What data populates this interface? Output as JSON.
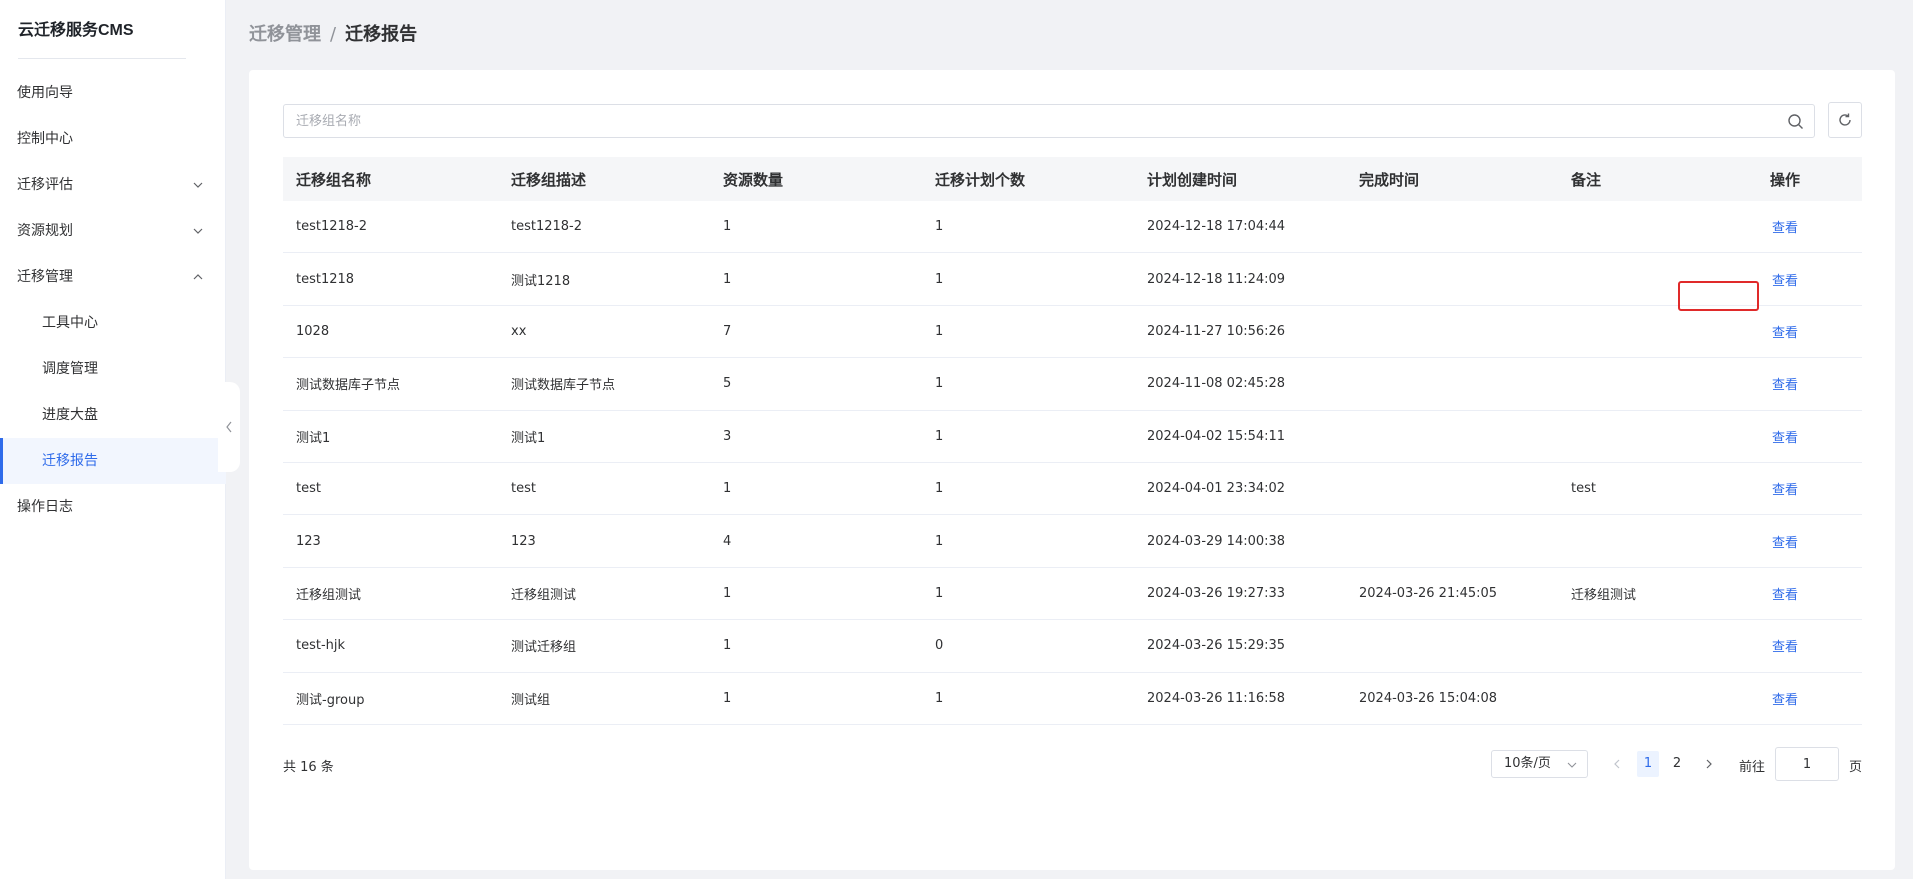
{
  "sidebar": {
    "brand": "云迁移服务CMS",
    "items": [
      {
        "label": "使用向导"
      },
      {
        "label": "控制中心"
      },
      {
        "label": "迁移评估"
      },
      {
        "label": "资源规划"
      },
      {
        "label": "迁移管理"
      },
      {
        "label": "工具中心"
      },
      {
        "label": "调度管理"
      },
      {
        "label": "进度大盘"
      },
      {
        "label": "迁移报告"
      },
      {
        "label": "操作日志"
      }
    ]
  },
  "breadcrumb": {
    "parent": "迁移管理",
    "separator": "/",
    "current": "迁移报告"
  },
  "search": {
    "placeholder": "迁移组名称",
    "value": ""
  },
  "table": {
    "headers": [
      "迁移组名称",
      "迁移组描述",
      "资源数量",
      "迁移计划个数",
      "计划创建时间",
      "完成时间",
      "备注",
      "操作"
    ],
    "rows": [
      {
        "name": "test1218-2",
        "desc": "test1218-2",
        "resources": "1",
        "plans": "1",
        "created": "2024-12-18 17:04:44",
        "completed": "",
        "note": "",
        "action": "查看"
      },
      {
        "name": "test1218",
        "desc": "测试1218",
        "resources": "1",
        "plans": "1",
        "created": "2024-12-18 11:24:09",
        "completed": "",
        "note": "",
        "action": "查看"
      },
      {
        "name": "1028",
        "desc": "xx",
        "resources": "7",
        "plans": "1",
        "created": "2024-11-27 10:56:26",
        "completed": "",
        "note": "",
        "action": "查看"
      },
      {
        "name": "测试数据库子节点",
        "desc": "测试数据库子节点",
        "resources": "5",
        "plans": "1",
        "created": "2024-11-08 02:45:28",
        "completed": "",
        "note": "",
        "action": "查看"
      },
      {
        "name": "测试1",
        "desc": "测试1",
        "resources": "3",
        "plans": "1",
        "created": "2024-04-02 15:54:11",
        "completed": "",
        "note": "",
        "action": "查看"
      },
      {
        "name": "test",
        "desc": "test",
        "resources": "1",
        "plans": "1",
        "created": "2024-04-01 23:34:02",
        "completed": "",
        "note": "test",
        "action": "查看"
      },
      {
        "name": "123",
        "desc": "123",
        "resources": "4",
        "plans": "1",
        "created": "2024-03-29 14:00:38",
        "completed": "",
        "note": "",
        "action": "查看"
      },
      {
        "name": "迁移组测试",
        "desc": "迁移组测试",
        "resources": "1",
        "plans": "1",
        "created": "2024-03-26 19:27:33",
        "completed": "2024-03-26 21:45:05",
        "note": "迁移组测试",
        "action": "查看"
      },
      {
        "name": "test-hjk",
        "desc": "测试迁移组",
        "resources": "1",
        "plans": "0",
        "created": "2024-03-26 15:29:35",
        "completed": "",
        "note": "",
        "action": "查看"
      },
      {
        "name": "测试-group",
        "desc": "测试组",
        "resources": "1",
        "plans": "1",
        "created": "2024-03-26 11:16:58",
        "completed": "2024-03-26 15:04:08",
        "note": "",
        "action": "查看"
      }
    ]
  },
  "pagination": {
    "total": "共 16 条",
    "page_size": "10条/页",
    "pages": [
      "1",
      "2"
    ],
    "current_page": "1",
    "goto_label": "前往",
    "goto_value": "1",
    "page_suffix": "页"
  },
  "colors": {
    "accent": "#2f6bea",
    "highlight": "#e02a2a",
    "background": "#f1f2f5"
  },
  "icons": [
    "search-icon",
    "refresh-icon",
    "chevron-down-icon",
    "chevron-up-icon",
    "chevron-left-icon",
    "chevron-right-icon"
  ]
}
